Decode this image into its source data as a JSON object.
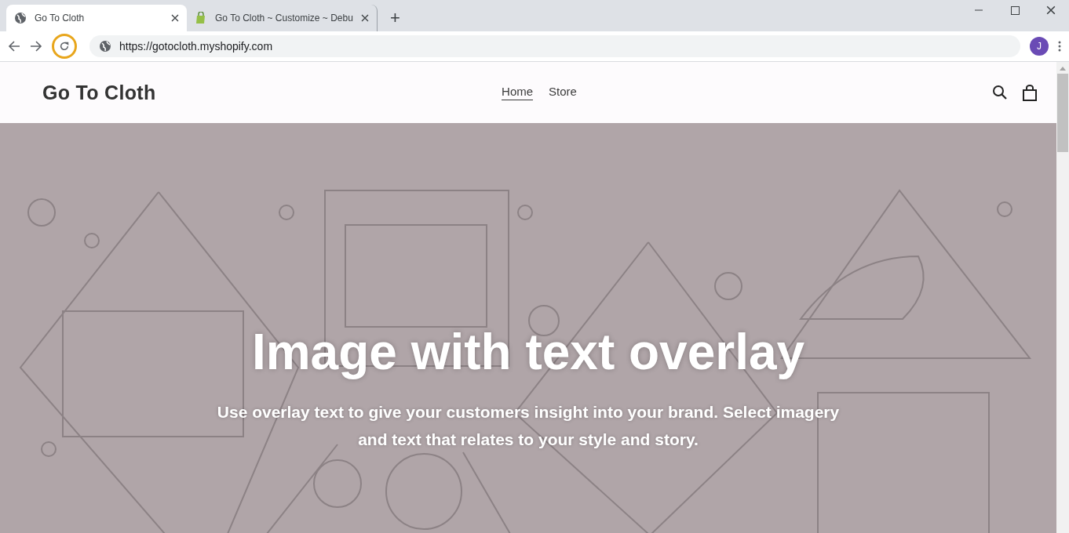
{
  "browser": {
    "tabs": [
      {
        "title": "Go To Cloth",
        "selected": true
      },
      {
        "title": "Go To Cloth ~ Customize ~ Debu",
        "selected": false
      }
    ],
    "new_tab": "+",
    "url": "https://gotocloth.myshopify.com",
    "profile_initial": "J"
  },
  "site": {
    "logo": "Go To Cloth",
    "nav": [
      {
        "label": "Home",
        "selected": true
      },
      {
        "label": "Store",
        "selected": false
      }
    ]
  },
  "hero": {
    "heading": "Image with text overlay",
    "text": "Use overlay text to give your customers insight into your brand. Select imagery and text that relates to your style and story."
  }
}
